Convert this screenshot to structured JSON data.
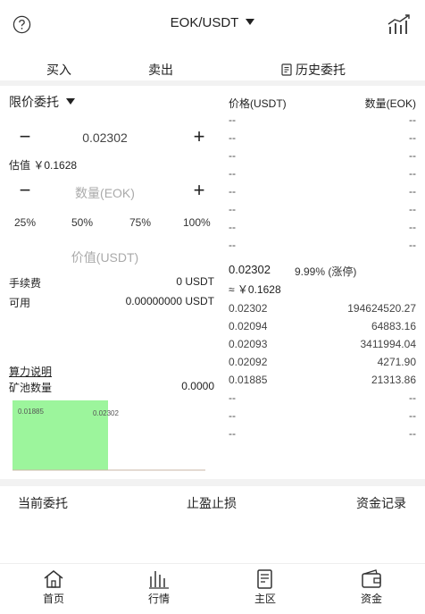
{
  "header": {
    "pair": "EOK/USDT"
  },
  "tabs": {
    "buy": "买入",
    "sell": "卖出",
    "history": "历史委托"
  },
  "order_form": {
    "order_type": "限价委托",
    "price": "0.02302",
    "estimate": "估值 ￥0.1628",
    "qty_placeholder": "数量(EOK)",
    "percents": [
      "25%",
      "50%",
      "75%",
      "100%"
    ],
    "price_placeholder": "价值(USDT)",
    "fee_label": "手续费",
    "fee_value": "0 USDT",
    "avail_label": "可用",
    "avail_value": "0.00000000 USDT",
    "hashrate_link": "算力说明",
    "pool_label": "矿池数量",
    "pool_value": "0.0000"
  },
  "mini_chart": {
    "left_label": "0.01885",
    "right_label": "0.02302",
    "fill_color": "#9cf59c"
  },
  "orderbook": {
    "price_header": "价格(USDT)",
    "qty_header": "数量(EOK)",
    "dash": "--",
    "last_price": "0.02302",
    "change": "9.99% (涨停)",
    "approx": "≈ ￥0.1628",
    "bids": [
      {
        "price": "0.02302",
        "qty": "194624520.27"
      },
      {
        "price": "0.02094",
        "qty": "64883.16"
      },
      {
        "price": "0.02093",
        "qty": "3411994.04"
      },
      {
        "price": "0.02092",
        "qty": "4271.90"
      },
      {
        "price": "0.01885",
        "qty": "21313.86"
      }
    ]
  },
  "bottom_tabs": {
    "current": "当前委托",
    "tpsl": "止盈止损",
    "funds": "资金记录"
  },
  "nav": {
    "home": "首页",
    "market": "行情",
    "zone": "主区",
    "assets": "资金"
  }
}
